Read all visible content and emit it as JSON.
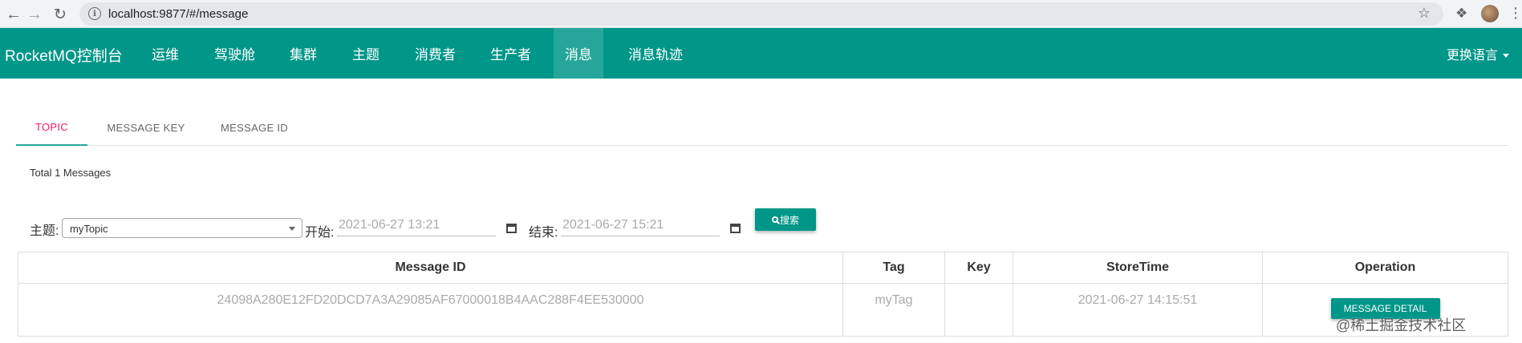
{
  "browser": {
    "url": "localhost:9877/#/message"
  },
  "appbar": {
    "brand": "RocketMQ控制台",
    "menu": [
      "运维",
      "驾驶舱",
      "集群",
      "主题",
      "消费者",
      "生产者",
      "消息",
      "消息轨迹"
    ],
    "active_index": 6,
    "language": "更换语言"
  },
  "tabs": [
    {
      "label": "TOPIC",
      "active": true
    },
    {
      "label": "MESSAGE KEY",
      "active": false
    },
    {
      "label": "MESSAGE ID",
      "active": false
    }
  ],
  "summary": {
    "total": "Total 1 Messages"
  },
  "filter": {
    "topic_label": "主题:",
    "topic_value": "myTopic",
    "start_label": "开始:",
    "start_placeholder": "2021-06-27 13:21",
    "end_label": "结束:",
    "end_placeholder": "2021-06-27 15:21",
    "search_label": "搜索"
  },
  "table": {
    "headers": [
      "Message ID",
      "Tag",
      "Key",
      "StoreTime",
      "Operation"
    ],
    "rows": [
      {
        "message_id": "24098A280E12FD20DCD7A3A29085AF67000018B4AAC288F4EE530000",
        "tag": "myTag",
        "key": "",
        "store_time": "2021-06-27 14:15:51",
        "operation": "MESSAGE DETAIL"
      }
    ]
  },
  "watermark": "@稀土掘金技术社区",
  "colors": {
    "primary": "#009688",
    "active_menu": "#26a69a",
    "active_tab_text": "#e91e63"
  }
}
